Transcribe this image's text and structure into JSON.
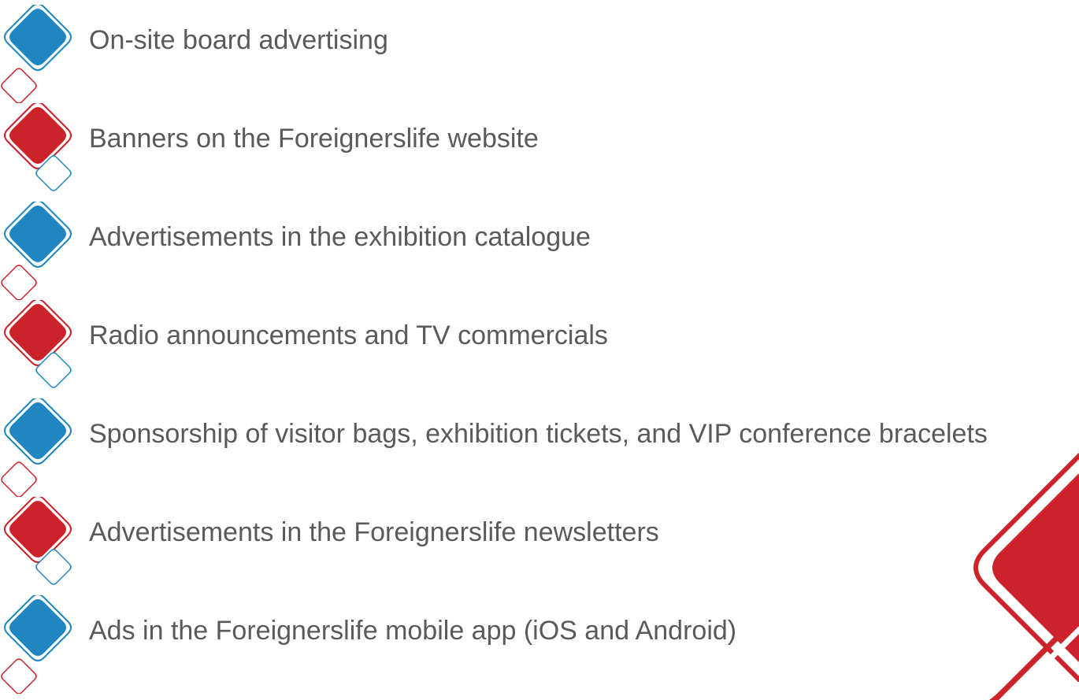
{
  "colors": {
    "blue": "#1f86c2",
    "red": "#cc2229",
    "text": "#5a5a5a"
  },
  "items": [
    {
      "label": "On-site board advertising",
      "color": "blue"
    },
    {
      "label": "Banners on the Foreignerslife website",
      "color": "red"
    },
    {
      "label": "Advertisements in the exhibition catalogue",
      "color": "blue"
    },
    {
      "label": "Radio announcements and TV commercials",
      "color": "red"
    },
    {
      "label": "Sponsorship of visitor bags, exhibition tickets, and VIP conference bracelets",
      "color": "blue"
    },
    {
      "label": "Advertisements in the Foreignerslife newsletters",
      "color": "red"
    },
    {
      "label": "Ads in the Foreignerslife mobile app (iOS and Android)",
      "color": "blue"
    }
  ]
}
